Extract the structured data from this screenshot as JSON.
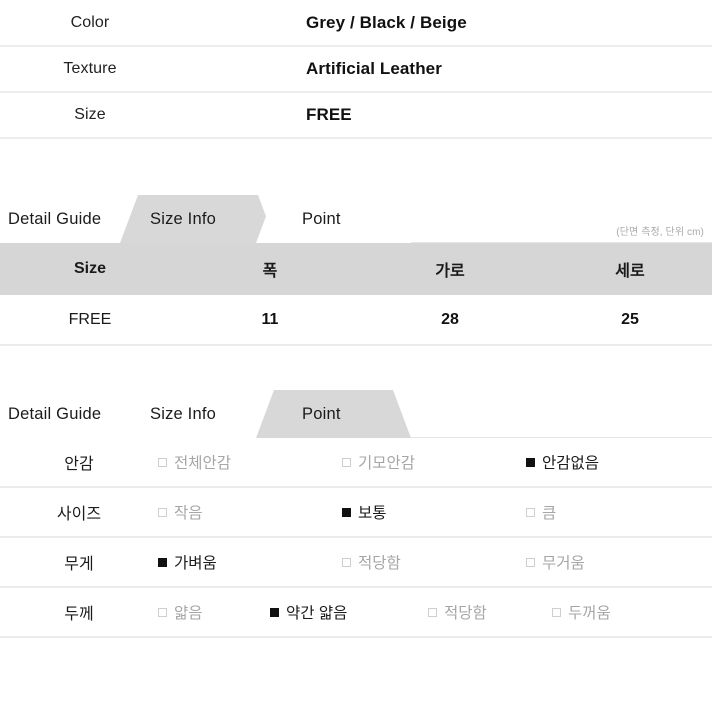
{
  "spec_table": {
    "rows": [
      {
        "key": "Color",
        "value": "Grey / Black / Beige"
      },
      {
        "key": "Texture",
        "value": "Artificial Leather"
      },
      {
        "key": "Size",
        "value": "FREE"
      }
    ]
  },
  "size_section": {
    "tabs": [
      {
        "label": "Detail Guide",
        "selected": false
      },
      {
        "label": "Size Info",
        "selected": true
      },
      {
        "label": "Point",
        "selected": false
      }
    ],
    "unit_note": "(단면 측정, 단위 cm)",
    "headers": [
      "Size",
      "폭",
      "가로",
      "세로"
    ],
    "rows": [
      [
        "FREE",
        "11",
        "28",
        "25"
      ]
    ]
  },
  "point_section": {
    "tabs": [
      {
        "label": "Detail Guide",
        "selected": false
      },
      {
        "label": "Size Info",
        "selected": false
      },
      {
        "label": "Point",
        "selected": true
      }
    ],
    "rows": [
      {
        "label": "안감",
        "options": [
          {
            "text": "전체안감",
            "checked": false
          },
          {
            "text": "기모안감",
            "checked": false
          },
          {
            "text": "안감없음",
            "checked": true
          }
        ]
      },
      {
        "label": "사이즈",
        "options": [
          {
            "text": "작음",
            "checked": false
          },
          {
            "text": "보통",
            "checked": true
          },
          {
            "text": "큼",
            "checked": false
          }
        ]
      },
      {
        "label": "무게",
        "options": [
          {
            "text": "가벼움",
            "checked": true
          },
          {
            "text": "적당함",
            "checked": false
          },
          {
            "text": "무거움",
            "checked": false
          }
        ]
      },
      {
        "label": "두께",
        "options": [
          {
            "text": "얇음",
            "checked": false
          },
          {
            "text": "약간 얇음",
            "checked": true
          },
          {
            "text": "적당함",
            "checked": false
          },
          {
            "text": "두꺼움",
            "checked": false
          }
        ]
      }
    ]
  },
  "colors": {
    "header_bg": "#d6d6d6",
    "tab_selected_bg": "#d8d8d8",
    "divider": "#ececec",
    "checked": "#111111",
    "unchecked_text": "#a6a6a6"
  }
}
